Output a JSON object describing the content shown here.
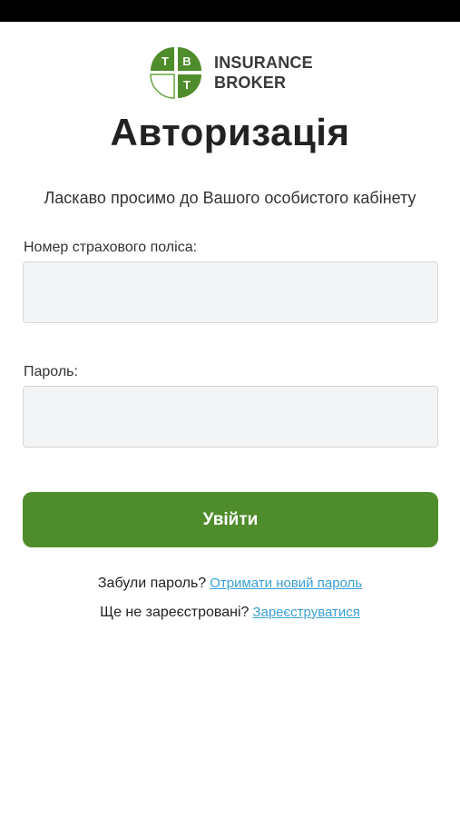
{
  "logo": {
    "letters": [
      "T",
      "B",
      "T"
    ],
    "line1": "INSURANCE",
    "line2": "BROKER",
    "brand_color": "#4f8c2b"
  },
  "title": "Авторизація",
  "welcome": "Ласкаво просимо до Вашого особистого кабінету",
  "form": {
    "policy_label": "Номер страхового поліса:",
    "policy_value": "",
    "password_label": "Пароль:",
    "password_value": "",
    "submit_label": "Увійти"
  },
  "links": {
    "forgot_text": "Забули пароль?",
    "forgot_link": "Отримати новий пароль",
    "register_text": "Ще не зареєстровані?",
    "register_link": "Зареєструватися",
    "link_color": "#3aa0d8"
  }
}
